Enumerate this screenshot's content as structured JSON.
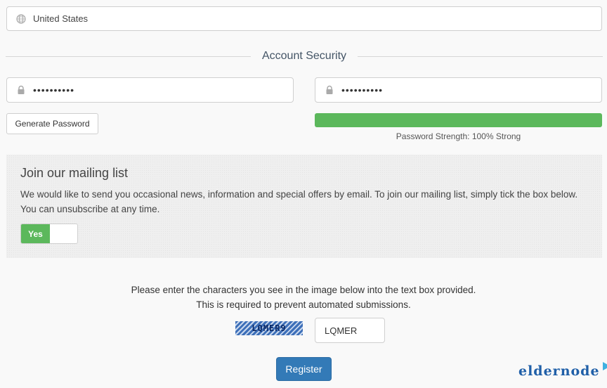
{
  "country": {
    "value": "United States",
    "icon": "globe-icon"
  },
  "section": {
    "title": "Account Security"
  },
  "password": {
    "value": "••••••••••",
    "icon": "lock-icon"
  },
  "confirm_password": {
    "value": "••••••••••",
    "icon": "lock-icon"
  },
  "generate_button": {
    "label": "Generate Password"
  },
  "strength": {
    "percent": 100,
    "label": "Password Strength: 100% Strong",
    "color": "#5cb85c"
  },
  "mailing": {
    "title": "Join our mailing list",
    "text": "We would like to send you occasional news, information and special offers by email. To join our mailing list, simply tick the box below. You can unsubscribe at any time.",
    "toggle_label": "Yes",
    "toggle_on": true
  },
  "captcha": {
    "line1": "Please enter the characters you see in the image below into the text box provided.",
    "line2": "This is required to prevent automated submissions.",
    "image_text": "LQMER9",
    "input_value": "LQMER"
  },
  "register_button": {
    "label": "Register"
  },
  "logo": {
    "text": "eldernode"
  },
  "colors": {
    "accent": "#337ab7",
    "success": "#5cb85c"
  }
}
